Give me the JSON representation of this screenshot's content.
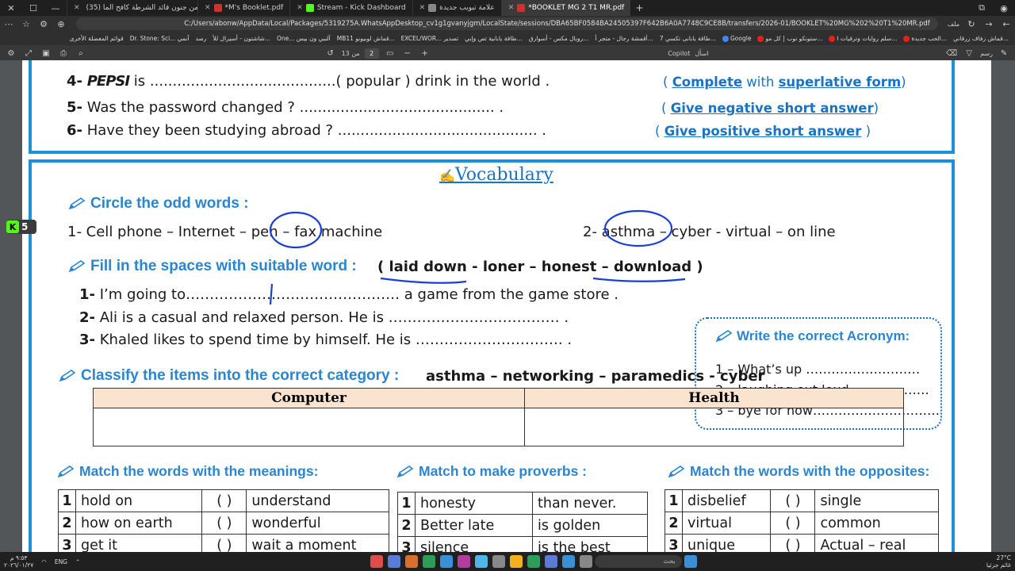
{
  "browser": {
    "tabs": [
      {
        "label": "(35) من جنون قائد الشرطة كافح الما...",
        "active": false,
        "color": "#e62117"
      },
      {
        "label": "*M's Booklet.pdf",
        "active": false,
        "color": "#d0312d"
      },
      {
        "label": "Stream - Kick Dashboard",
        "active": false,
        "color": "#53fc18"
      },
      {
        "label": "علامة تبويب جديدة",
        "active": false,
        "color": "#888888"
      },
      {
        "label": "*BOOKLET MG 2 T1 MR.pdf",
        "active": true,
        "color": "#d0312d"
      }
    ],
    "url": "C:/Users/abonw/AppData/Local/Packages/5319275A.WhatsAppDesktop_cv1g1gvanyjgm/LocalState/sessions/DBA65BF0584BA24505397F642B6A0A7748C9CE8B/transfers/2026-01/BOOKLET%20MG%202%20T1%20MR.pdf",
    "file_label": "ملف",
    "bookmarks": [
      "الحب جديدة...",
      "سلم روايات وترقيات ا...",
      "ستونكو نوب | كل مو...",
      "Google",
      "قماش زفاف زرقاني...",
      "طاقة يابانى تكسي 7...",
      "أقمشة رجال - متجر أ...",
      "روبال مكس - أسوارق...",
      "طاقة يابانية تص وإبي...",
      "EXCEL/WOR... تصدير",
      "MB11 قماش لوبيونو...",
      "One... آلنبي ون بيس",
      "شاشتون - أسيرال للأ...",
      "رصد",
      "Dr. Stone: Sci... آنمي",
      "قوائم المفضلة الأخرى"
    ],
    "pdf_toolbar": {
      "page": "2",
      "total": "من 13",
      "copilot": "Copilot",
      "ask": "اسأل",
      "draw": "رسم"
    }
  },
  "doc": {
    "prev_questions": [
      {
        "num": "4-",
        "before": "",
        "brand": "PEPSI",
        "after": " is .........................................( popular ) drink in the world  .",
        "hint_pre": "( ",
        "hint_u1": "Complete",
        "hint_mid": " with ",
        "hint_u2": "superlative form",
        "hint_post": ")"
      },
      {
        "num": "5-",
        "before": "Was the password changed ?",
        "after": " ........................................... .",
        "hint_pre": "( ",
        "hint_u1": "Give negative short answer",
        "hint_post": ")"
      },
      {
        "num": "6-",
        "before": "Have they been studying abroad ?",
        "after": " ............................................ .",
        "hint_pre": "( ",
        "hint_u1": "Give positive short answer",
        "hint_post": " )"
      }
    ],
    "badge": {
      "k": "K",
      "n": "5"
    },
    "vocab_title": "Vocabulary",
    "odd": {
      "heading": "Circle the odd words :",
      "line1": "1-  Cell phone  – Internet  – pen – fax machine",
      "line2": "2-  asthma – cyber -  virtual  –  on line"
    },
    "fill": {
      "heading": "Fill  in the spaces with suitable word :",
      "choices": "( laid down - loner – honest – download )",
      "lines": [
        {
          "num": "1-",
          "text": "I’m going to……………………………………… a game from the game store ."
        },
        {
          "num": "2-",
          "text": " Ali is a casual and relaxed person. He is  ………………………………   ."
        },
        {
          "num": "3-",
          "text": "Khaled likes to spend time by himself. He is ………………………….   ."
        }
      ]
    },
    "acronym": {
      "heading": "Write the correct Acronym:",
      "lines": [
        "1 – What’s up ………………………",
        "2 – laughing out loud ………………",
        "3 – bye for now…………………………"
      ]
    },
    "classify": {
      "heading": "Classify the items into the correct category :",
      "items": "asthma – networking – paramedics  - cyber",
      "columns": [
        "Computer",
        "Health"
      ]
    },
    "match_meanings": {
      "heading": "Match the words with the meanings:",
      "rows": [
        {
          "n": "1",
          "left": "hold on",
          "paren": "(   )",
          "right": "understand"
        },
        {
          "n": "2",
          "left": "how on earth",
          "paren": "(   )",
          "right": "wonderful"
        },
        {
          "n": "3",
          "left": "get it",
          "paren": "(   )",
          "right": "wait a moment"
        }
      ]
    },
    "match_proverbs": {
      "heading": "Match to make proverbs :",
      "rows": [
        {
          "n": "1",
          "left": "honesty",
          "right": "than never."
        },
        {
          "n": "2",
          "left": "Better late",
          "right": "is golden"
        },
        {
          "n": "3",
          "left": "silence",
          "right": "is the best"
        }
      ]
    },
    "match_opposites": {
      "heading": "Match the words with the opposites:",
      "rows": [
        {
          "n": "1",
          "left": "disbelief",
          "paren": "(   )",
          "right": "single"
        },
        {
          "n": "2",
          "left": "virtual",
          "paren": "(   )",
          "right": "common"
        },
        {
          "n": "3",
          "left": "unique",
          "paren": "(   )",
          "right": "Actual – real"
        }
      ]
    }
  },
  "taskbar": {
    "search": "بحث",
    "lang": "ENG",
    "time": "٩:٥٣ م",
    "date": "٢٠٢٦/٠١/٢٧",
    "weather": "27°C",
    "weather_text": "غائم جزئيا"
  }
}
